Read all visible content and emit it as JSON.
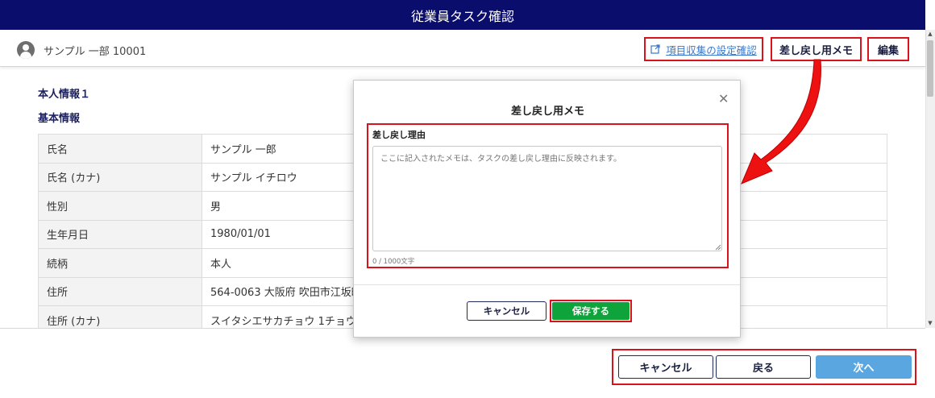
{
  "window": {
    "title": "従業員タスク確認"
  },
  "header": {
    "user_name": "サンプル 一部 10001",
    "settings_link": "項目収集の設定確認",
    "memo_button": "差し戻し用メモ",
    "edit_button": "編集"
  },
  "sections": {
    "personal_info": "本人情報１",
    "basic_info": "基本情報"
  },
  "table": {
    "rows": [
      {
        "label": "氏名",
        "value": "サンプル 一郎"
      },
      {
        "label": "氏名 (カナ)",
        "value": "サンプル イチロウ"
      },
      {
        "label": "性別",
        "value": "男"
      },
      {
        "label": "生年月日",
        "value": "1980/01/01"
      },
      {
        "label": "続柄",
        "value": "本人"
      },
      {
        "label": "住所",
        "value": "564-0063 大阪府 吹田市江坂町"
      },
      {
        "label": "住所 (カナ)",
        "value": "スイタシエサカチョウ 1チョウ"
      }
    ]
  },
  "modal": {
    "title": "差し戻し用メモ",
    "field_label": "差し戻し理由",
    "placeholder": "ここに記入されたメモは、タスクの差し戻し理由に反映されます。",
    "value": "",
    "char_count": "0 / 1000文字",
    "cancel_button": "キャンセル",
    "save_button": "保存する"
  },
  "footer": {
    "cancel_button": "キャンセル",
    "back_button": "戻る",
    "next_button": "次へ"
  },
  "colors": {
    "title_bar": "#0a0d6b",
    "highlight": "#d9131c",
    "save": "#0fa33b",
    "next": "#5aa6e0",
    "link": "#3a78c9"
  }
}
